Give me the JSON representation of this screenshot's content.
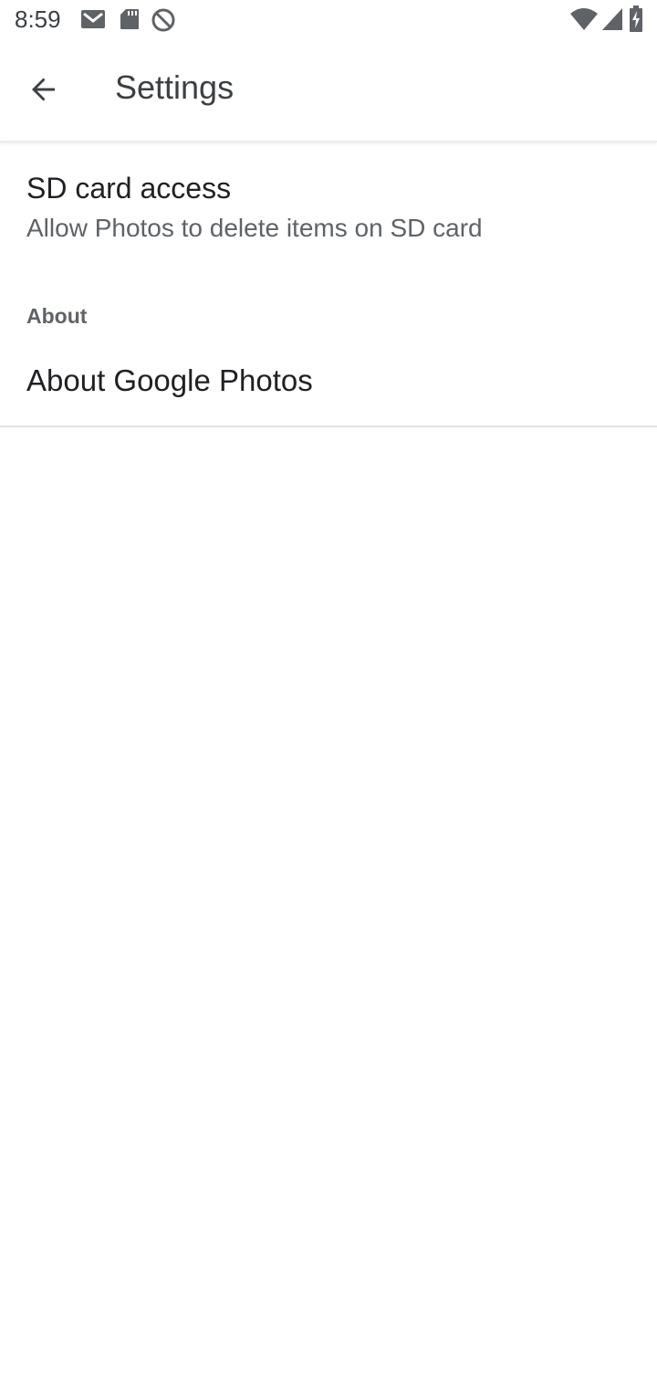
{
  "status_bar": {
    "time": "8:59",
    "icons": [
      "gmail-icon",
      "sd-card-icon",
      "do-not-disturb-icon",
      "wifi-icon",
      "signal-icon",
      "battery-icon"
    ]
  },
  "app_bar": {
    "title": "Settings",
    "back_icon": "arrow-back-icon"
  },
  "settings": {
    "sd_card": {
      "title": "SD card access",
      "summary": "Allow Photos to delete items on SD card"
    },
    "about_section": {
      "header": "About",
      "items": [
        {
          "title": "About Google Photos"
        }
      ]
    }
  },
  "colors": {
    "background": "#ffffff",
    "title_text": "#202124",
    "secondary_text": "#5f6368",
    "divider": "#e0e0e0"
  }
}
